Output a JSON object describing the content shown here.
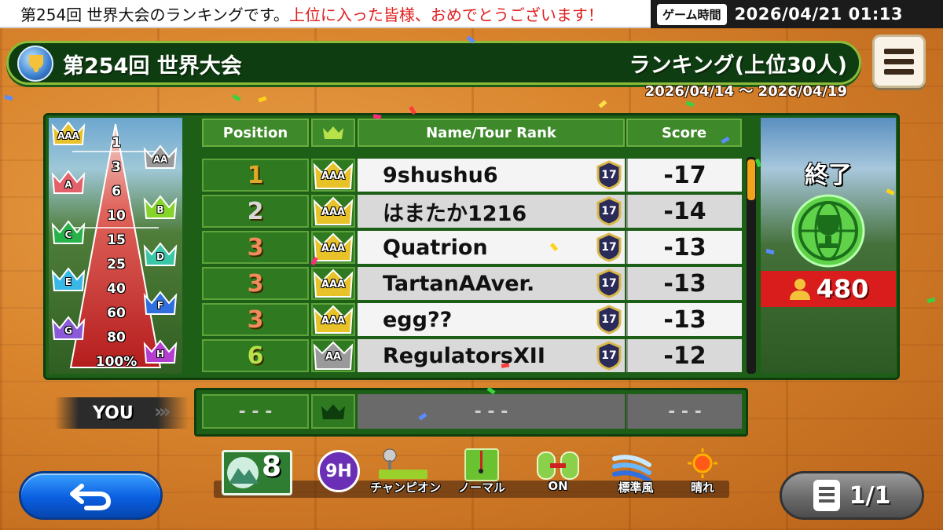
{
  "ticker": {
    "text_black": "第254回 世界大会のランキングです。",
    "text_red": "上位に入った皆様、おめでとうございます！"
  },
  "game_time": {
    "label": "ゲーム時間",
    "value": "2026/04/21 01:13"
  },
  "header": {
    "title": "第254回 世界大会",
    "ranking_label": "ランキング(上位30人)",
    "date_range": "2026/04/14 ～ 2026/04/19"
  },
  "pyramid": {
    "percent_labels": [
      "1",
      "3",
      "6",
      "10",
      "15",
      "25",
      "40",
      "60",
      "80",
      "100%"
    ],
    "crown_labels": [
      "AAA",
      "AA",
      "A",
      "B",
      "C",
      "D",
      "E",
      "F",
      "G",
      "H"
    ]
  },
  "table": {
    "headers": {
      "position": "Position",
      "name": "Name/Tour Rank",
      "score": "Score"
    },
    "rows": [
      {
        "position": "1",
        "crown": "AAA",
        "name": "9shushu6",
        "tour_rank": "17",
        "score": "-17"
      },
      {
        "position": "2",
        "crown": "AAA",
        "name": "はまたか1216",
        "tour_rank": "17",
        "score": "-14"
      },
      {
        "position": "3",
        "crown": "AAA",
        "name": "Quatrion",
        "tour_rank": "17",
        "score": "-13"
      },
      {
        "position": "3",
        "crown": "AAA",
        "name": "TartanAAver.",
        "tour_rank": "17",
        "score": "-13"
      },
      {
        "position": "3",
        "crown": "AAA",
        "name": "egg??",
        "tour_rank": "17",
        "score": "-13"
      },
      {
        "position": "6",
        "crown": "AA",
        "name": "RegulatorsXII",
        "tour_rank": "17",
        "score": "-12"
      }
    ]
  },
  "you_row": {
    "label": "YOU",
    "position": "- - -",
    "name": "- - -",
    "score": "- - -"
  },
  "status": {
    "text": "終了",
    "participants": "480"
  },
  "conditions": {
    "course_count": "8",
    "holes": "9H",
    "tee_label": "チャンピオン",
    "pin_label": "ノーマル",
    "assist_label": "ON",
    "wind_label": "標準風",
    "weather_label": "晴れ"
  },
  "pagination": {
    "label": "1/1"
  },
  "colors": {
    "accent_green": "#1d5f17",
    "header_bar": "#0f3d12",
    "rank_gold": "#f2a31a",
    "participants_red": "#d91c1c",
    "back_button_blue": "#0a5fe0"
  }
}
